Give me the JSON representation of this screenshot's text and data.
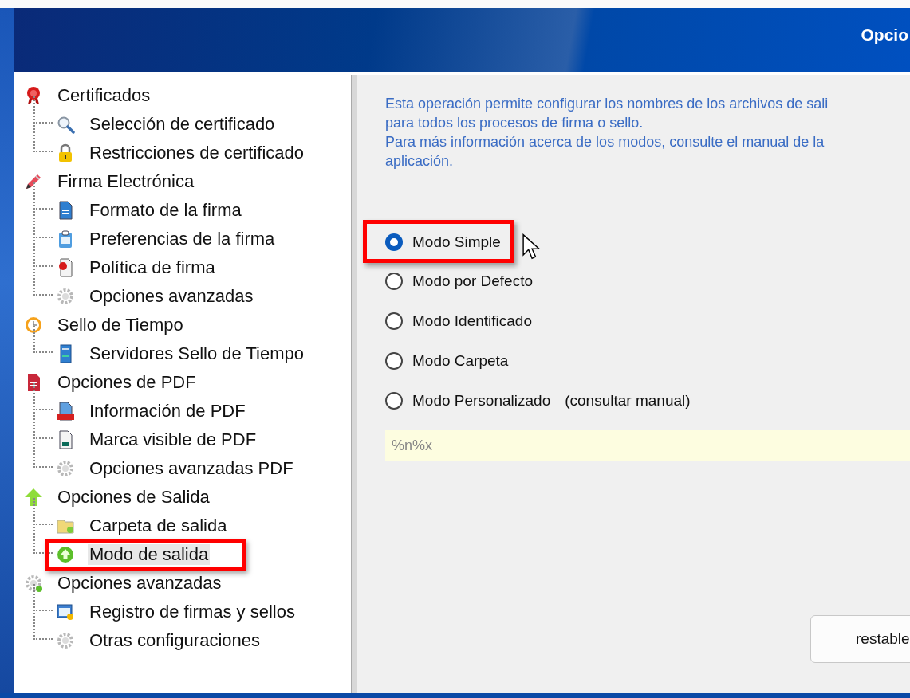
{
  "window": {
    "title": "Opcio"
  },
  "tree": [
    {
      "label": "Certificados",
      "selected": false,
      "children": [
        {
          "label": "Selección de certificado",
          "selected": false
        },
        {
          "label": "Restricciones de certificado",
          "selected": false
        }
      ]
    },
    {
      "label": "Firma Electrónica",
      "selected": false,
      "children": [
        {
          "label": "Formato de la firma",
          "selected": false
        },
        {
          "label": "Preferencias de la firma",
          "selected": false
        },
        {
          "label": "Política de firma",
          "selected": false
        },
        {
          "label": "Opciones avanzadas",
          "selected": false
        }
      ]
    },
    {
      "label": "Sello de Tiempo",
      "selected": false,
      "children": [
        {
          "label": "Servidores Sello de Tiempo",
          "selected": false
        }
      ]
    },
    {
      "label": "Opciones de PDF",
      "selected": false,
      "children": [
        {
          "label": "Información de PDF",
          "selected": false
        },
        {
          "label": "Marca visible de PDF",
          "selected": false
        },
        {
          "label": "Opciones avanzadas PDF",
          "selected": false
        }
      ]
    },
    {
      "label": "Opciones de Salida",
      "selected": false,
      "children": [
        {
          "label": "Carpeta de salida",
          "selected": false
        },
        {
          "label": "Modo de salida",
          "selected": true
        }
      ]
    },
    {
      "label": "Opciones avanzadas",
      "selected": false,
      "children": [
        {
          "label": "Registro de firmas y sellos",
          "selected": false
        },
        {
          "label": "Otras configuraciones",
          "selected": false
        }
      ]
    }
  ],
  "description": [
    "Esta operación permite configurar los nombres de los archivos de sali",
    "para todos los procesos de firma o sello.",
    "Para más información acerca de los modos, consulte el manual de la",
    "aplicación."
  ],
  "modes": [
    {
      "label": "Modo Simple",
      "selected": true
    },
    {
      "label": "Modo por Defecto",
      "selected": false
    },
    {
      "label": "Modo Identificado",
      "selected": false
    },
    {
      "label": "Modo Carpeta",
      "selected": false
    },
    {
      "label": "Modo Personalizado",
      "note": "(consultar manual)",
      "selected": false
    }
  ],
  "pattern_field": {
    "value": "%n%x"
  },
  "buttons": [
    "restable"
  ]
}
